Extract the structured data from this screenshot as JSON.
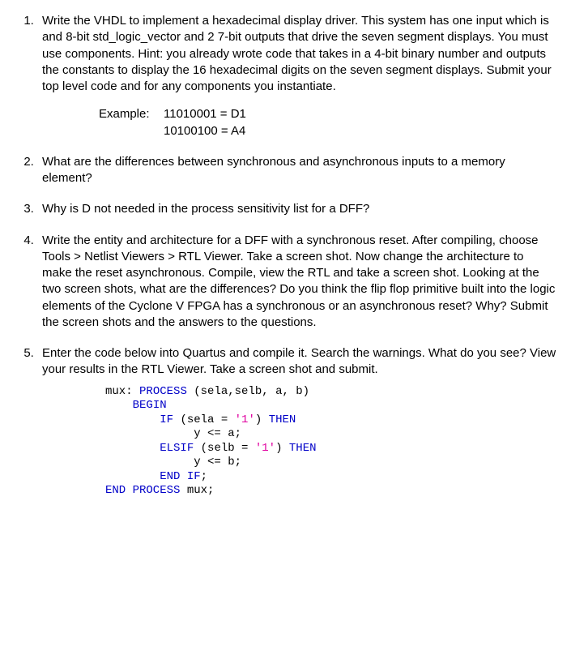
{
  "questions": {
    "q1": "Write the VHDL to implement a hexadecimal display driver. This system has one input which is and 8-bit std_logic_vector and 2 7-bit outputs that drive the seven segment displays. You must use components. Hint: you already wrote code that takes in a 4-bit binary number and outputs the constants to display the 16 hexadecimal digits on the seven segment displays. Submit your top level code and for any components you instantiate.",
    "q1_example_label": "Example:",
    "q1_example_line1": "11010001 = D1",
    "q1_example_line2": "10100100 = A4",
    "q2": "What are the differences between synchronous and asynchronous inputs to a memory element?",
    "q3": "Why is D not needed in the process sensitivity list for a DFF?",
    "q4": "Write the entity and architecture for a DFF with a synchronous reset. After compiling, choose Tools > Netlist Viewers > RTL Viewer. Take a screen shot. Now change the architecture to make the reset asynchronous. Compile, view the RTL and take a screen shot. Looking at the two screen shots, what are the differences? Do you think the flip flop primitive built into the logic elements of the Cyclone V FPGA has a synchronous or an asynchronous reset? Why? Submit the screen shots and the answers to the questions.",
    "q5": "Enter the code below into Quartus and compile it.  Search the warnings. What do you see?  View your results in the RTL Viewer.  Take a screen shot and submit."
  },
  "code": {
    "kw_process": "PROCESS",
    "kw_begin": "BEGIN",
    "kw_if": "IF",
    "kw_then": "THEN",
    "kw_elsif": "ELSIF",
    "kw_endif": "END IF",
    "kw_endprocess": "END PROCESS",
    "name_mux": "mux",
    "sens_list": "(sela,selb, a, b)",
    "cond1_a": "(sela = ",
    "cond1_b": ")",
    "cond2_a": "(selb = ",
    "cond2_b": ")",
    "lit1": "'1'",
    "lit2": "'1'",
    "assign1": "y <= a;",
    "assign2": "y <= b;",
    "semi": ";",
    "colon": ":"
  }
}
